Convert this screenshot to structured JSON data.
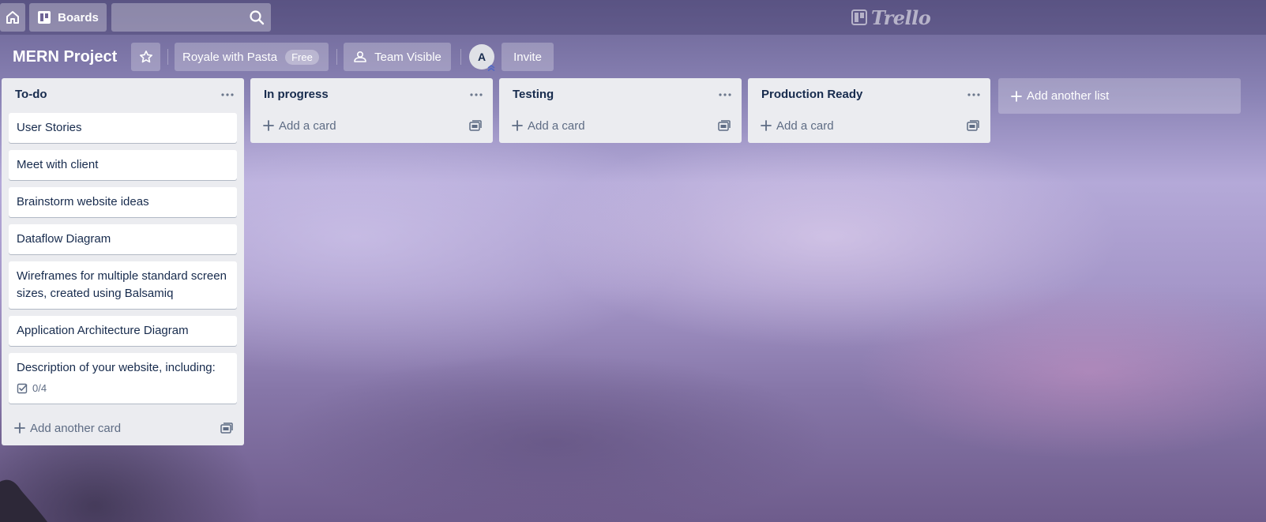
{
  "header": {
    "boards_label": "Boards",
    "search_placeholder": "",
    "logo_text": "Trello"
  },
  "board": {
    "title": "MERN Project",
    "team_name": "Royale with Pasta",
    "team_plan": "Free",
    "visibility": "Team Visible",
    "avatar_initial": "A",
    "invite_label": "Invite"
  },
  "lists": [
    {
      "title": "To-do",
      "cards": [
        {
          "title": "User Stories"
        },
        {
          "title": "Meet with client"
        },
        {
          "title": "Brainstorm website ideas"
        },
        {
          "title": "Dataflow Diagram"
        },
        {
          "title": "Wireframes for multiple standard screen sizes, created using Balsamiq"
        },
        {
          "title": "Application Architecture Diagram"
        },
        {
          "title": "Description of your website, including:",
          "checklist": "0/4"
        }
      ],
      "add_label": "Add another card"
    },
    {
      "title": "In progress",
      "cards": [],
      "add_label": "Add a card"
    },
    {
      "title": "Testing",
      "cards": [],
      "add_label": "Add a card"
    },
    {
      "title": "Production Ready",
      "cards": [],
      "add_label": "Add a card"
    }
  ],
  "add_list_label": "Add another list",
  "colors": {
    "list_bg": "#ebecf0",
    "card_bg": "#ffffff",
    "text": "#172b4d",
    "muted": "#5e6c84"
  }
}
